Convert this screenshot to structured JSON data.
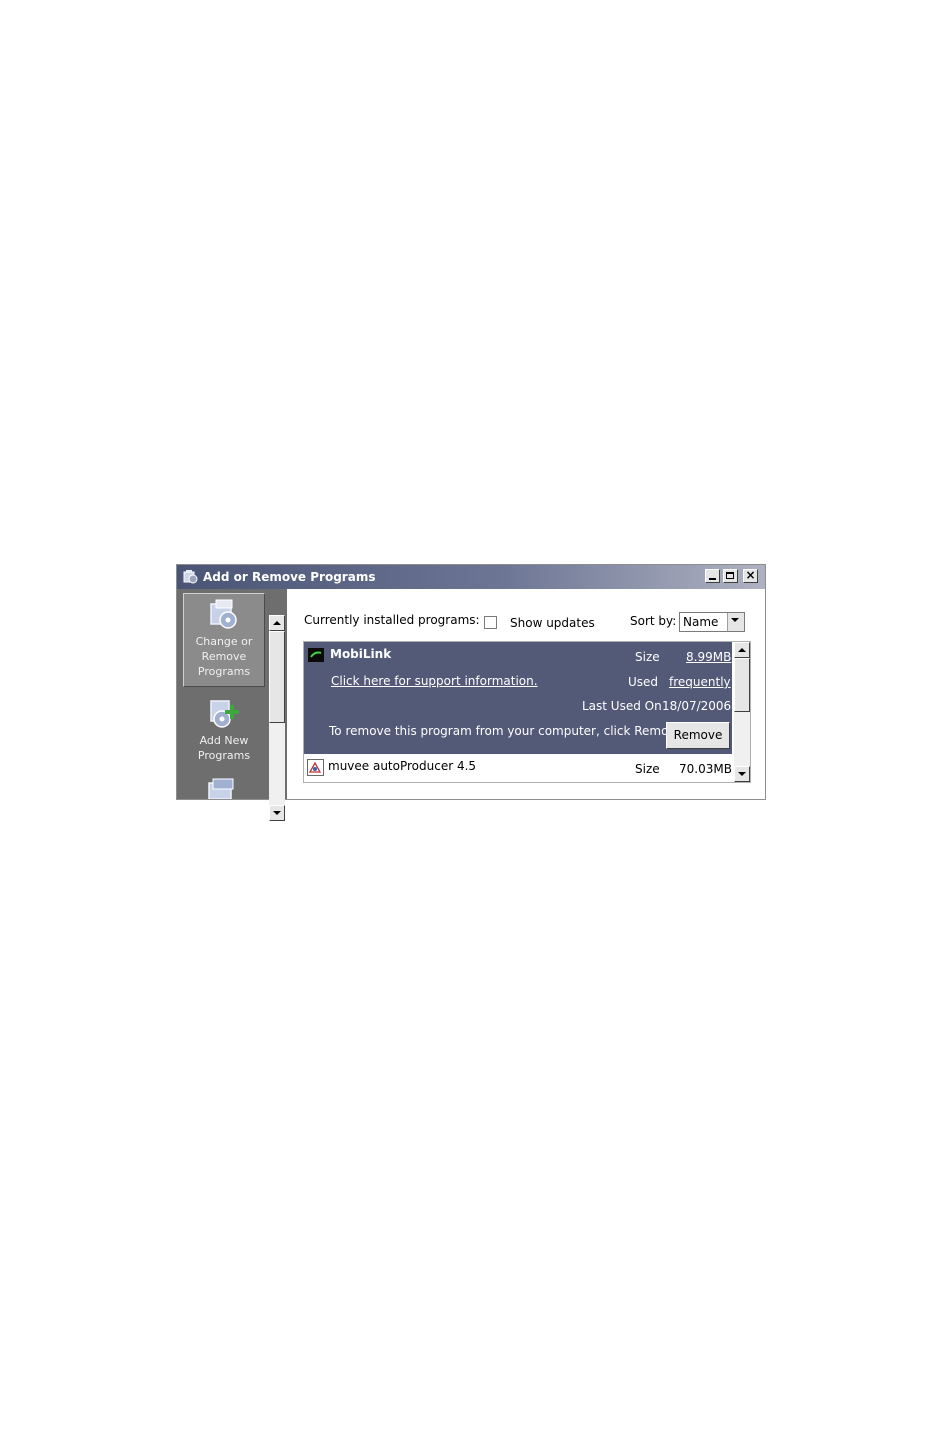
{
  "window": {
    "title": "Add or Remove Programs"
  },
  "sidebar": {
    "items": [
      {
        "label": "Change or\nRemove\nPrograms",
        "icon": "change-remove-programs-icon",
        "active": true
      },
      {
        "label": "Add New\nPrograms",
        "icon": "add-new-programs-icon",
        "active": false
      }
    ]
  },
  "toolbar": {
    "installed_label": "Currently installed programs:",
    "show_updates_label": "Show updates",
    "show_updates_checked": false,
    "sort_by_label": "Sort by:",
    "sort_by_value": "Name"
  },
  "programs": {
    "selected": {
      "name": "MobiLink",
      "size_label": "Size",
      "size": "8.99MB",
      "support_link": "Click here for support information.",
      "used_label": "Used",
      "used": "frequently",
      "last_used_label": "Last Used On",
      "last_used": "18/07/2006",
      "remove_text": "To remove this program from your computer, click Remove.",
      "remove_button": "Remove"
    },
    "next": {
      "name": "muvee autoProducer 4.5",
      "size_label": "Size",
      "size": "70.03MB"
    }
  },
  "colors": {
    "selection_bg": "#535a78",
    "sidebar_bg": "#6e6e6e",
    "titlebar": "#4a5474"
  }
}
